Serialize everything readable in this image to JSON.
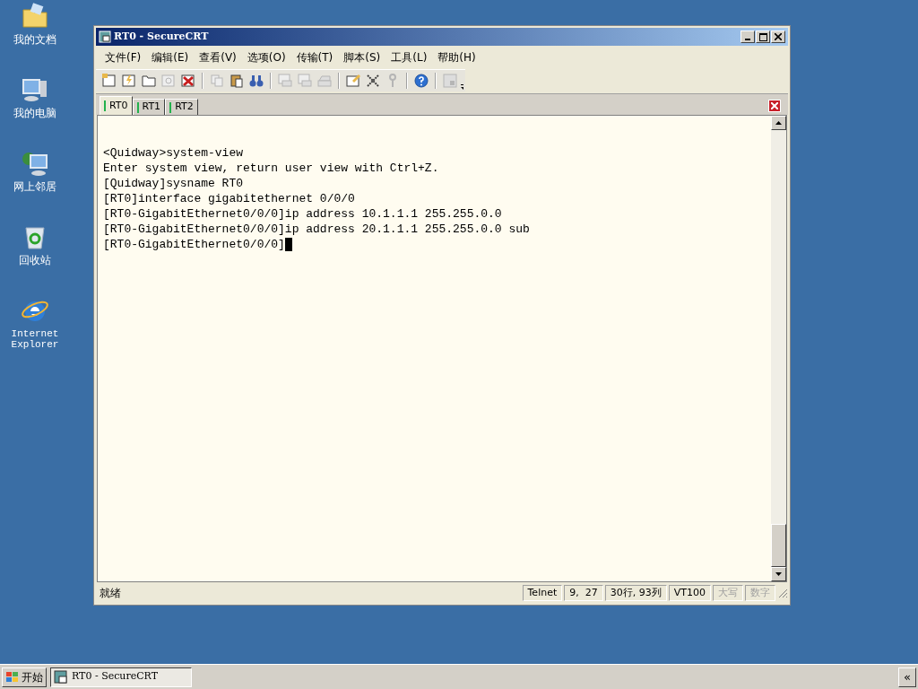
{
  "desktop_icons": [
    {
      "kind": "documents",
      "label": "我的文档"
    },
    {
      "kind": "computer",
      "label": "我的电脑"
    },
    {
      "kind": "network",
      "label": "网上邻居"
    },
    {
      "kind": "recycle",
      "label": "回收站"
    },
    {
      "kind": "ie",
      "label": "Internet Explorer"
    }
  ],
  "window": {
    "title": "RT0 - SecureCRT"
  },
  "menu": [
    "文件(F)",
    "编辑(E)",
    "查看(V)",
    "选项(O)",
    "传输(T)",
    "脚本(S)",
    "工具(L)",
    "帮助(H)"
  ],
  "toolbar": [
    {
      "kind": "new",
      "disabled": false
    },
    {
      "kind": "quick",
      "disabled": false
    },
    {
      "kind": "tab",
      "disabled": false
    },
    {
      "kind": "reconnect",
      "disabled": true
    },
    {
      "kind": "disconnect",
      "disabled": false
    },
    {
      "kind": "separator"
    },
    {
      "kind": "copy",
      "disabled": true
    },
    {
      "kind": "paste",
      "disabled": false
    },
    {
      "kind": "find",
      "disabled": false
    },
    {
      "kind": "separator"
    },
    {
      "kind": "print",
      "disabled": true
    },
    {
      "kind": "print",
      "disabled": true
    },
    {
      "kind": "printer",
      "disabled": true
    },
    {
      "kind": "separator"
    },
    {
      "kind": "options",
      "disabled": false
    },
    {
      "kind": "tools",
      "disabled": false
    },
    {
      "kind": "key",
      "disabled": true
    },
    {
      "kind": "separator"
    },
    {
      "kind": "help",
      "disabled": false
    },
    {
      "kind": "separator"
    },
    {
      "kind": "keymap",
      "disabled": true
    }
  ],
  "tabs": [
    {
      "label": "RT0",
      "selected": true,
      "connected": true
    },
    {
      "label": "RT1",
      "selected": false,
      "connected": true
    },
    {
      "label": "RT2",
      "selected": false,
      "connected": true
    }
  ],
  "terminal": {
    "lines": [
      "<Quidway>system-view",
      "Enter system view, return user view with Ctrl+Z.",
      "[Quidway]sysname RT0",
      "[RT0]interface gigabitethernet 0/0/0",
      "[RT0-GigabitEthernet0/0/0]ip address 10.1.1.1 255.255.0.0",
      "[RT0-GigabitEthernet0/0/0]ip address 20.1.1.1 255.255.0.0 sub",
      "[RT0-GigabitEthernet0/0/0]"
    ]
  },
  "status_bar": {
    "message": "就绪",
    "fields": [
      {
        "text": "Telnet",
        "disabled": false
      },
      {
        "text": "9,  27",
        "disabled": false
      },
      {
        "text": "30行, 93列",
        "disabled": false
      },
      {
        "text": "VT100",
        "disabled": false
      },
      {
        "text": "大写",
        "disabled": true
      },
      {
        "text": "数字",
        "disabled": true
      }
    ]
  },
  "taskbar": {
    "start": "开始",
    "tasks": [
      {
        "label": "RT0 - SecureCRT",
        "selected": true
      }
    ],
    "toggle": "«"
  }
}
